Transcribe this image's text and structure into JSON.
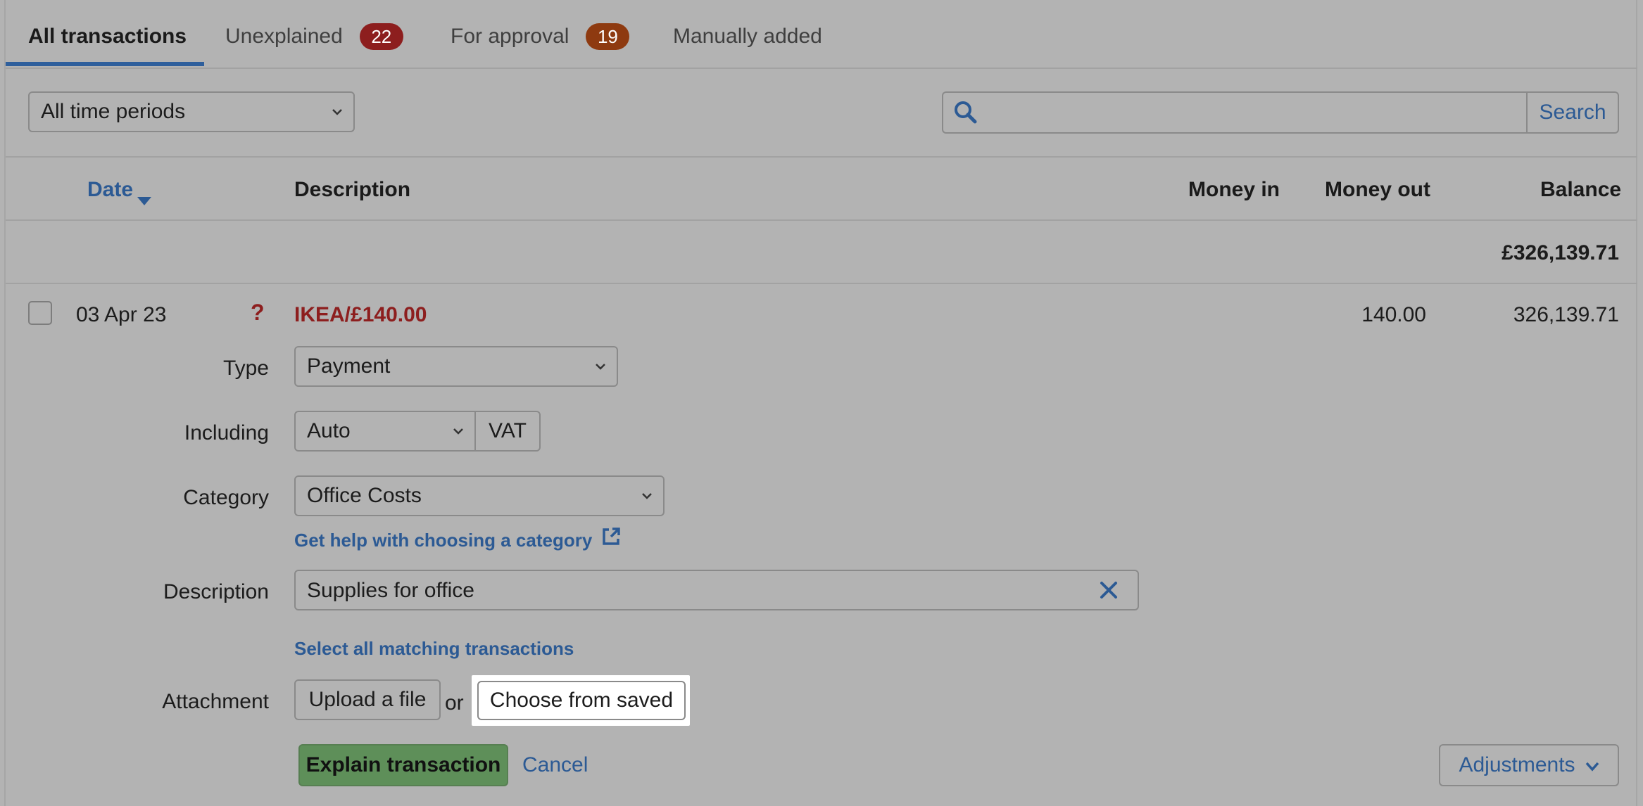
{
  "tabs": [
    {
      "label": "All transactions"
    },
    {
      "label": "Unexplained",
      "badge": "22"
    },
    {
      "label": "For approval",
      "badge": "19"
    },
    {
      "label": "Manually added"
    }
  ],
  "filters": {
    "period_selected": "All time periods",
    "search_placeholder": "",
    "search_label": "Search"
  },
  "table": {
    "headers": {
      "date": "Date",
      "description": "Description",
      "money_in": "Money in",
      "money_out": "Money out",
      "balance": "Balance"
    },
    "opening_balance": "£326,139.71",
    "row": {
      "date": "03 Apr 23",
      "status_glyph": "?",
      "description": "IKEA/£140.00",
      "money_out": "140.00",
      "balance": "326,139.71"
    }
  },
  "form": {
    "type_label": "Type",
    "type_value": "Payment",
    "including_label": "Including",
    "including_value": "Auto",
    "vat_label": "VAT",
    "category_label": "Category",
    "category_value": "Office Costs",
    "category_help": "Get help with choosing a category",
    "description_label": "Description",
    "description_value": "Supplies for office",
    "select_matching": "Select all matching transactions",
    "attachment_label": "Attachment",
    "upload_label": "Upload a file",
    "or_text": "or",
    "choose_saved_label": "Choose from saved",
    "explain_label": "Explain transaction",
    "cancel_label": "Cancel",
    "adjustments_label": "Adjustments"
  },
  "colors": {
    "accent": "#2c5a94",
    "unexplained_red": "#8d1e1e",
    "approval_orange": "#8e3a10",
    "primary_green": "#5e8f59"
  }
}
